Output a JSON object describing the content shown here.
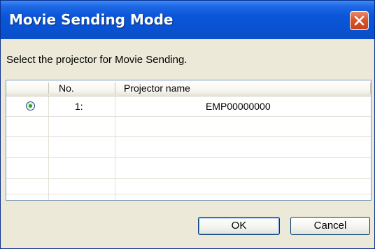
{
  "dialog": {
    "title": "Movie Sending Mode",
    "prompt": "Select the projector for Movie Sending."
  },
  "list": {
    "columns": {
      "no": "No.",
      "name": "Projector name"
    },
    "rows": [
      {
        "selected": true,
        "no": "1:",
        "name": "EMP00000000"
      }
    ]
  },
  "buttons": {
    "ok": "OK",
    "cancel": "Cancel"
  },
  "icons": {
    "close": "close-icon",
    "radio": "radio-selected-icon"
  },
  "colors": {
    "titlebar": "#0a56d8",
    "close_button": "#d9562e",
    "radio_dot": "#21a121",
    "dialog_background": "#ece9d8"
  }
}
